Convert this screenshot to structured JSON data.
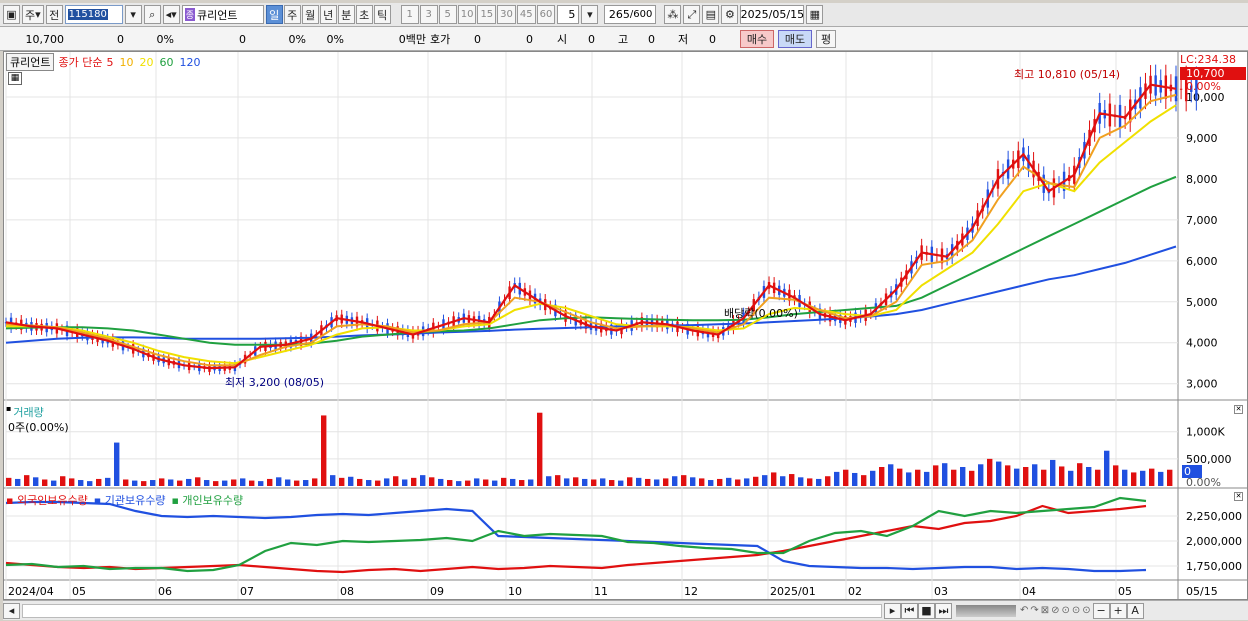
{
  "toolbar": {
    "type_label": "주",
    "prev_label": "전",
    "code": "115180",
    "market_badge": "종",
    "stock_name": "큐리언트",
    "periods": [
      "일",
      "주",
      "월",
      "년",
      "분",
      "초",
      "틱"
    ],
    "active_period": "일",
    "intervals": [
      "1",
      "3",
      "5",
      "10",
      "15",
      "30",
      "45",
      "60"
    ],
    "interval_value": "5",
    "count": "265",
    "count_total": "/600",
    "date": "2025/05/15"
  },
  "quote": {
    "price": "10,700",
    "change": "0",
    "change_pct": "0%",
    "volume": "0",
    "vol_pct": "0%",
    "pct3": "0%",
    "amount": "0백만",
    "hoga_label": "호가",
    "hoga1": "0",
    "hoga2": "0",
    "open_label": "시",
    "open": "0",
    "high_label": "고",
    "high": "0",
    "low_label": "저",
    "low": "0",
    "buy": "매수",
    "sell": "매도",
    "eval": "평"
  },
  "price_panel": {
    "title": "큐리언트",
    "ma_label": "종가 단순",
    "ma_periods": [
      "5",
      "10",
      "20",
      "60",
      "120"
    ],
    "ma_colors": [
      "#e01010",
      "#f0b000",
      "#f0e000",
      "#20a040",
      "#2050e0"
    ],
    "lc": "LC:234.38",
    "current": "10,700",
    "change_pct": "0.00%",
    "high_note": "최고 10,810 (05/14)",
    "low_note": "최저 3,200 (08/05)",
    "dividend_note": "배당락(0.00%)",
    "y_ticks": [
      "10,000",
      "9,000",
      "8,000",
      "7,000",
      "6,000",
      "5,000",
      "4,000",
      "3,000"
    ]
  },
  "volume_panel": {
    "title": "거래량",
    "value": "0주(0.00%)",
    "y_ticks": [
      "1,000K",
      "500,000",
      "0.00%"
    ],
    "current": "0"
  },
  "holding_panel": {
    "series": [
      {
        "name": "외국인보유수량",
        "color": "#e01010"
      },
      {
        "name": "기관보유수량",
        "color": "#2050e0"
      },
      {
        "name": "개인보유수량",
        "color": "#20a040"
      }
    ],
    "y_ticks": [
      "2,250,000",
      "2,000,000",
      "1,750,000"
    ]
  },
  "x_axis": {
    "labels": [
      "2024/04",
      "05",
      "06",
      "07",
      "08",
      "09",
      "10",
      "11",
      "12",
      "2025/01",
      "02",
      "03",
      "04",
      "05"
    ],
    "end_label": "05/15"
  },
  "chart_data": [
    {
      "type": "line",
      "name": "price",
      "ylim": [
        2700,
        11000
      ],
      "series": [
        {
          "name": "5",
          "color": "#e01010",
          "values": [
            4500,
            4400,
            4350,
            4200,
            4050,
            3850,
            3600,
            3450,
            3380,
            3400,
            3900,
            3950,
            4100,
            4600,
            4500,
            4350,
            4200,
            4400,
            4600,
            4500,
            5400,
            5000,
            4650,
            4400,
            4300,
            4500,
            4450,
            4300,
            4200,
            4600,
            5400,
            5100,
            4700,
            4550,
            4700,
            5300,
            6200,
            6100,
            6800,
            8000,
            8600,
            7700,
            8100,
            9600,
            9500,
            10300,
            10200
          ]
        },
        {
          "name": "10",
          "color": "#f0a020",
          "values": [
            4450,
            4420,
            4380,
            4250,
            4100,
            3900,
            3700,
            3550,
            3450,
            3450,
            3700,
            3900,
            4000,
            4400,
            4450,
            4400,
            4250,
            4300,
            4450,
            4500,
            5100,
            5000,
            4750,
            4500,
            4350,
            4400,
            4430,
            4350,
            4250,
            4450,
            5100,
            5050,
            4800,
            4600,
            4650,
            5000,
            5900,
            6000,
            6500,
            7500,
            8300,
            7900,
            7800,
            9000,
            9300,
            9900,
            10050
          ]
        },
        {
          "name": "20",
          "color": "#f0e000",
          "values": [
            4400,
            4400,
            4380,
            4300,
            4150,
            4000,
            3800,
            3650,
            3550,
            3500,
            3650,
            3800,
            3950,
            4200,
            4350,
            4380,
            4300,
            4300,
            4400,
            4450,
            4800,
            4950,
            4850,
            4650,
            4450,
            4400,
            4400,
            4380,
            4300,
            4350,
            4700,
            4850,
            4800,
            4700,
            4650,
            4800,
            5400,
            5800,
            6200,
            6900,
            7700,
            7900,
            7700,
            8400,
            8900,
            9400,
            9800
          ]
        },
        {
          "name": "60",
          "color": "#20a040",
          "values": [
            4350,
            4370,
            4380,
            4380,
            4350,
            4300,
            4200,
            4100,
            4000,
            3950,
            3950,
            3950,
            3980,
            4050,
            4150,
            4200,
            4250,
            4280,
            4300,
            4350,
            4450,
            4550,
            4600,
            4620,
            4600,
            4580,
            4560,
            4550,
            4550,
            4560,
            4620,
            4700,
            4750,
            4800,
            4850,
            4900,
            5100,
            5400,
            5700,
            6000,
            6300,
            6600,
            6900,
            7200,
            7500,
            7800,
            8050
          ]
        },
        {
          "name": "120",
          "color": "#2050e0",
          "values": [
            4000,
            4050,
            4100,
            4120,
            4130,
            4130,
            4120,
            4100,
            4100,
            4100,
            4100,
            4110,
            4120,
            4150,
            4180,
            4200,
            4220,
            4250,
            4270,
            4290,
            4320,
            4340,
            4360,
            4380,
            4400,
            4410,
            4420,
            4430,
            4450,
            4470,
            4500,
            4530,
            4560,
            4600,
            4640,
            4700,
            4800,
            4950,
            5100,
            5250,
            5400,
            5550,
            5650,
            5800,
            5950,
            6150,
            6350
          ]
        }
      ]
    },
    {
      "type": "bar",
      "name": "volume",
      "ylim": [
        0,
        1400000
      ],
      "values": [
        150,
        130,
        200,
        160,
        120,
        100,
        180,
        140,
        110,
        90,
        130,
        150,
        800,
        120,
        100,
        90,
        110,
        140,
        120,
        100,
        130,
        160,
        110,
        90,
        100,
        120,
        140,
        100,
        90,
        130,
        160,
        120,
        100,
        110,
        140,
        1300,
        200,
        150,
        170,
        130,
        110,
        100,
        140,
        180,
        120,
        150,
        200,
        160,
        130,
        110,
        90,
        100,
        140,
        120,
        100,
        150,
        130,
        110,
        120,
        1350,
        180,
        200,
        140,
        160,
        130,
        120,
        140,
        110,
        100,
        160,
        150,
        130,
        120,
        140,
        180,
        200,
        160,
        140,
        110,
        130,
        150,
        120,
        140,
        170,
        200,
        250,
        180,
        220,
        160,
        140,
        130,
        180,
        260,
        300,
        240,
        200,
        280,
        350,
        400,
        320,
        250,
        300,
        260,
        380,
        420,
        300,
        350,
        280,
        400,
        500,
        450,
        380,
        320,
        350,
        400,
        300,
        480,
        360,
        280,
        420,
        350,
        300,
        650,
        380,
        300,
        250,
        280,
        320,
        260,
        300
      ],
      "colors": [
        "r",
        "b",
        "r",
        "b",
        "r",
        "b",
        "r",
        "r",
        "b",
        "b",
        "r",
        "b",
        "b",
        "r",
        "b",
        "r",
        "b",
        "r",
        "b",
        "r",
        "b",
        "r",
        "b",
        "r",
        "b",
        "r",
        "b",
        "r",
        "b",
        "r",
        "b",
        "b",
        "r",
        "b",
        "r",
        "r",
        "b",
        "r",
        "b",
        "r",
        "b",
        "r",
        "b",
        "r",
        "b",
        "r",
        "b",
        "r",
        "b",
        "r",
        "b",
        "r",
        "b",
        "r",
        "b",
        "r",
        "b",
        "r",
        "b",
        "r",
        "b",
        "r",
        "b",
        "r",
        "b",
        "r",
        "b",
        "r",
        "b",
        "r",
        "b",
        "r",
        "b",
        "r",
        "b",
        "r",
        "b",
        "r",
        "b",
        "r",
        "b",
        "r",
        "b",
        "r",
        "b",
        "r",
        "b",
        "r",
        "b",
        "r",
        "b",
        "r",
        "b",
        "r",
        "b",
        "r",
        "b",
        "r",
        "b",
        "r",
        "b",
        "r",
        "b",
        "r",
        "b",
        "r",
        "b",
        "r",
        "b",
        "r",
        "b",
        "r",
        "b",
        "r",
        "b",
        "r",
        "b",
        "r",
        "b",
        "r",
        "b",
        "r",
        "b",
        "r",
        "b",
        "r",
        "b",
        "r",
        "b",
        "r"
      ]
    },
    {
      "type": "line",
      "name": "holdings",
      "ylim": [
        1650000,
        2450000
      ],
      "series": [
        {
          "name": "외국인보유수량",
          "values": [
            1780000,
            1760000,
            1740000,
            1730000,
            1740000,
            1720000,
            1730000,
            1740000,
            1750000,
            1760000,
            1740000,
            1720000,
            1700000,
            1690000,
            1710000,
            1720000,
            1700000,
            1720000,
            1740000,
            1720000,
            1730000,
            1750000,
            1740000,
            1730000,
            1760000,
            1780000,
            1800000,
            1820000,
            1840000,
            1860000,
            1900000,
            1950000,
            2000000,
            2050000,
            2100000,
            2150000,
            2120000,
            2180000,
            2200000,
            2250000,
            2350000,
            2280000,
            2300000,
            2320000,
            2350000
          ]
        },
        {
          "name": "기관보유수량",
          "values": [
            2380000,
            2390000,
            2390000,
            2380000,
            2370000,
            2300000,
            2250000,
            2240000,
            2250000,
            2240000,
            2230000,
            2240000,
            2260000,
            2270000,
            2260000,
            2280000,
            2300000,
            2320000,
            2300000,
            2050000,
            2040000,
            2030000,
            2020000,
            2010000,
            2000000,
            1990000,
            1980000,
            1970000,
            1960000,
            1950000,
            1800000,
            1750000,
            1740000,
            1730000,
            1730000,
            1720000,
            1730000,
            1740000,
            1740000,
            1720000,
            1730000,
            1720000,
            1700000,
            1700000,
            1710000
          ]
        },
        {
          "name": "개인보유수량",
          "values": [
            1760000,
            1770000,
            1740000,
            1750000,
            1720000,
            1730000,
            1730000,
            1700000,
            1710000,
            1760000,
            1900000,
            1980000,
            1960000,
            2000000,
            1990000,
            2000000,
            2010000,
            2030000,
            2000000,
            2100000,
            2050000,
            2070000,
            2060000,
            2050000,
            1990000,
            1980000,
            1950000,
            1930000,
            1920000,
            1880000,
            1880000,
            2000000,
            2080000,
            2100000,
            2050000,
            2150000,
            2300000,
            2250000,
            2300000,
            2280000,
            2300000,
            2320000,
            2340000,
            2430000,
            2400000
          ]
        }
      ]
    }
  ]
}
